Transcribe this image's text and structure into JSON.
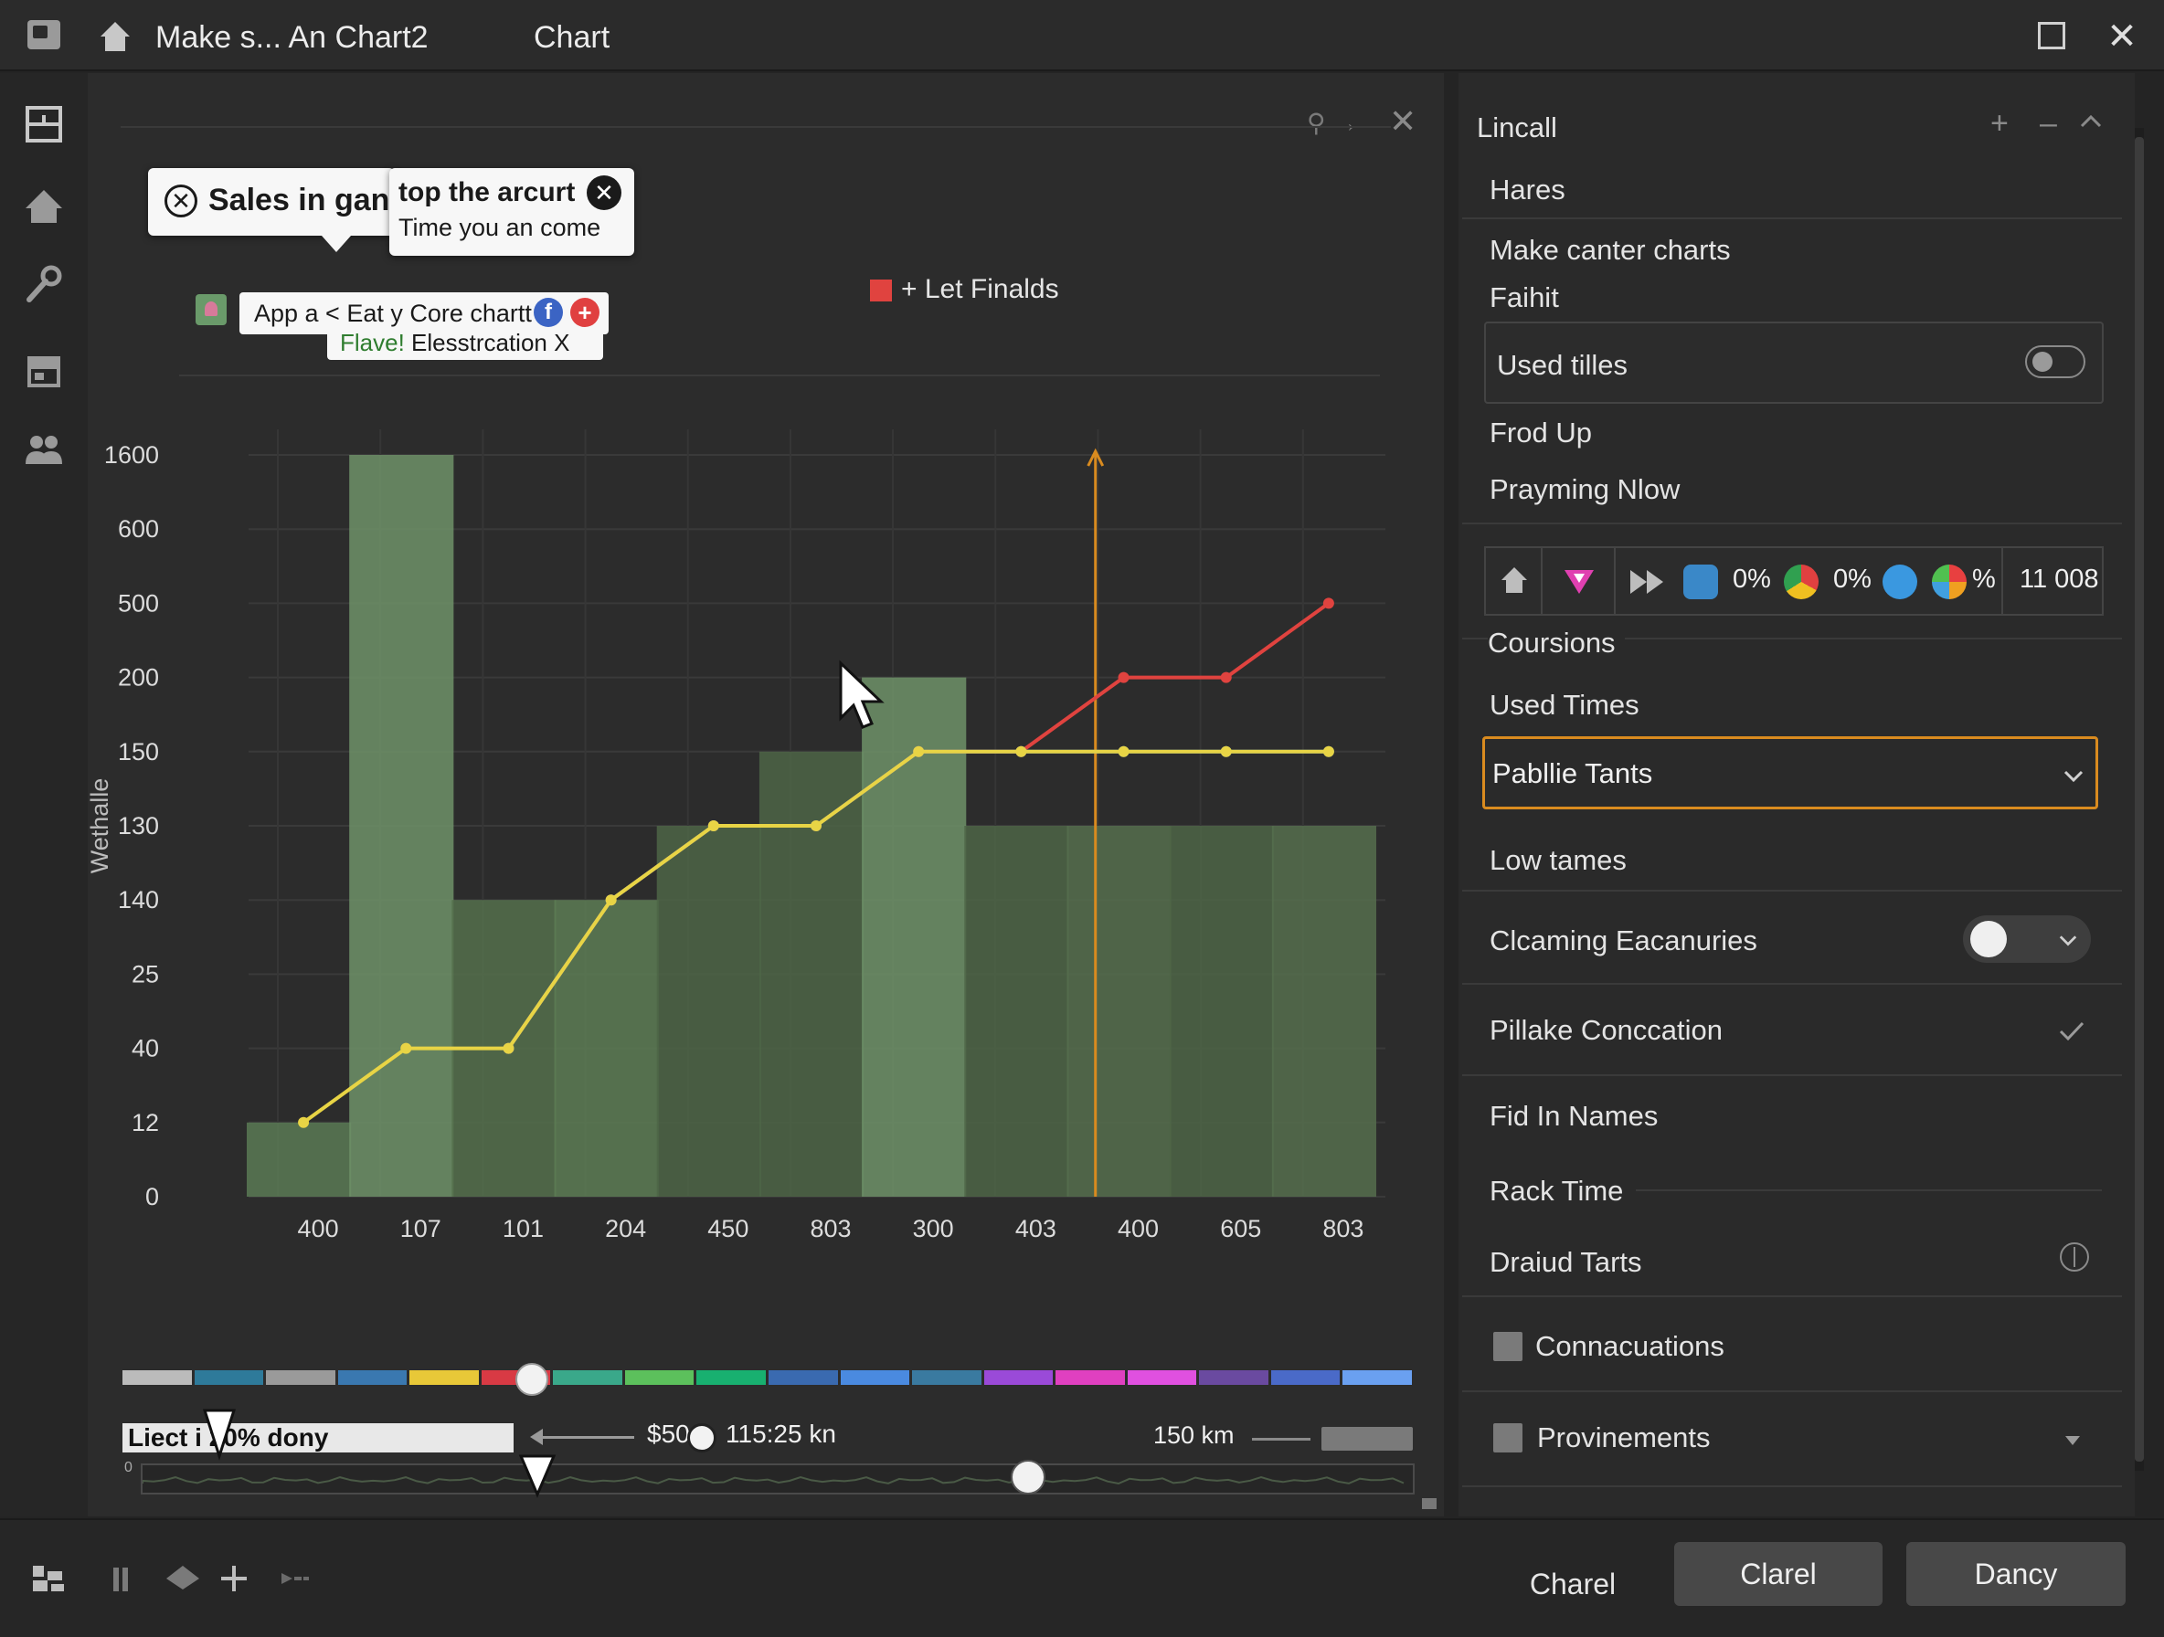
{
  "window": {
    "title": "Make s... An Chart2",
    "subtitle": "Chart"
  },
  "tooltips": {
    "sales": "Sales in gan.",
    "top_title": "top the arcurt",
    "top_sub": "Time you an come",
    "tag_line1": "App a < Eat y Core chartt",
    "tag_line2_prefix": "Flave!",
    "tag_line2_rest": " Elesstrcation X"
  },
  "legend": {
    "label": "+ Let Finalds",
    "color": "#e0433f"
  },
  "chart_data": {
    "type": "bar",
    "ylabel": "Wethalle",
    "categories": [
      "400",
      "107",
      "101",
      "204",
      "450",
      "803",
      "300",
      "403",
      "400",
      "605",
      "803"
    ],
    "y_ticks": [
      "1600",
      "600",
      "500",
      "200",
      "150",
      "130",
      "140",
      "25",
      "40",
      "12",
      "0"
    ],
    "bars": [
      {
        "value": "12",
        "color": "#5b7a55"
      },
      {
        "value": "1600",
        "color": "#6f9268"
      },
      {
        "value": "140",
        "color": "#55704c"
      },
      {
        "value": "140",
        "color": "#5d7c55"
      },
      {
        "value": "130",
        "color": "#4e6547"
      },
      {
        "value": "150",
        "color": "#4e6547"
      },
      {
        "value": "200",
        "color": "#6f9268"
      },
      {
        "value": "130",
        "color": "#4e6547"
      },
      {
        "value": "130",
        "color": "#566e4d"
      },
      {
        "value": "130",
        "color": "#4e6547"
      },
      {
        "value": "130",
        "color": "#566e4d"
      }
    ],
    "series": [
      {
        "color": "#e0433f",
        "values": [
          null,
          null,
          "40",
          "140",
          "130",
          "130",
          "150",
          "150",
          "200",
          "200",
          "500"
        ]
      },
      {
        "color": "#4a90d0",
        "values": [
          null,
          null,
          "40",
          "140",
          "130",
          "130",
          "150",
          "150",
          "150",
          "150",
          "150"
        ]
      },
      {
        "color": "#e8d445",
        "values": [
          "12",
          "40",
          "40",
          "140",
          "130",
          "130",
          "150",
          "150",
          "150",
          "150",
          "150"
        ]
      }
    ],
    "marker_line": {
      "color": "#d98b1f"
    }
  },
  "controls": {
    "range_label": "Liect i 20% dony",
    "price": "$50",
    "time": "115:25 kn",
    "km": "150 km",
    "timeline_zero": "0"
  },
  "palette": [
    {
      "color": "#bbbbbb"
    },
    {
      "color": "#2e7a9a"
    },
    {
      "color": "#9a9a9a"
    },
    {
      "color": "#3a78b0"
    },
    {
      "color": "#e8c838"
    },
    {
      "color": "#d83a44"
    },
    {
      "color": "#3aa88a"
    },
    {
      "color": "#5cc05c"
    },
    {
      "color": "#18b070"
    },
    {
      "color": "#3a6ab0"
    },
    {
      "color": "#4a8ae0"
    },
    {
      "color": "#3a7aa0"
    },
    {
      "color": "#9a4ad8"
    },
    {
      "color": "#e040c0"
    },
    {
      "color": "#e050e0"
    },
    {
      "color": "#6a4aa0"
    },
    {
      "color": "#4a6ac8"
    },
    {
      "color": "#6aa0f0"
    }
  ],
  "side": {
    "header": "Lincall",
    "items": {
      "hares": "Hares",
      "make_canter": "Make canter charts",
      "faihit": "Faihit",
      "used_tilles": "Used tilles",
      "frod_up": "Frod Up",
      "prayming": "Prayming Nlow",
      "coursions": "Coursions",
      "used_times": "Used Times",
      "select_value": "Pabllie Tants",
      "low_tames": "Low tames",
      "claming": "Clcaming Eacanuries",
      "pillake": "Pillake Conccation",
      "fid_in_names": "Fid In Names",
      "rack_time": "Rack Time",
      "draiud_tarts": "Draiud Tarts",
      "connacuations": "Connacuations",
      "provinements": "Provinements"
    },
    "iconbar": {
      "pct1": "0%",
      "pct2": "0%",
      "pct3": "%",
      "count": "11 008"
    }
  },
  "bottom": {
    "charel": "Charel",
    "clarel": "Clarel",
    "dancy": "Dancy"
  }
}
